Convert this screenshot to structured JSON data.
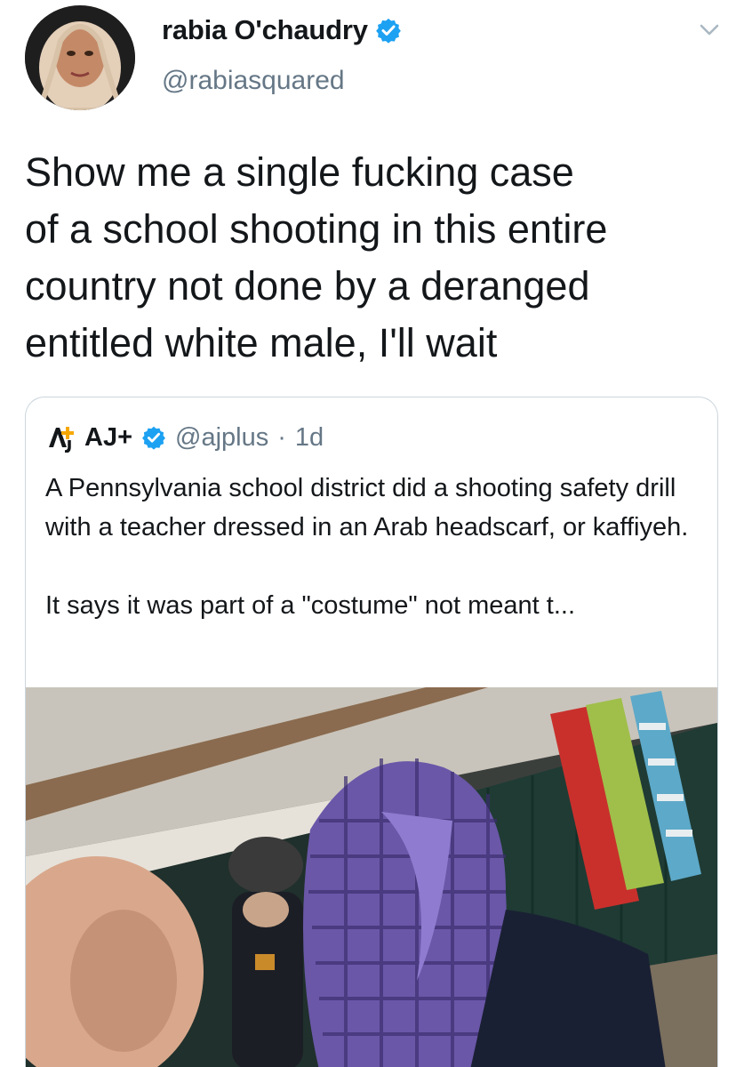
{
  "tweet": {
    "display_name": "rabia O'chaudry",
    "handle": "@rabiasquared",
    "text": "Show me a single fucking case\nof a school shooting in this entire\ncountry not done by a deranged\nentitled white male, I'll wait",
    "verified_icon": "verified-badge-icon",
    "menu_icon": "chevron-down-icon"
  },
  "quote": {
    "logo_icon": "ajplus-logo-icon",
    "display_name": "AJ+",
    "handle": "@ajplus",
    "separator": "·",
    "time": "1d",
    "text_paragraph_1": "A Pennsylvania school district did a shooting safety drill with a teacher dressed in an Arab headscarf, or kaffiyeh.",
    "text_paragraph_2": "It says it was part of a \"costume\" not meant t..."
  },
  "colors": {
    "verified": "#1da1f2",
    "secondary_text": "#657786",
    "border": "#ccd6dd",
    "scarf": "#6a57a8"
  }
}
